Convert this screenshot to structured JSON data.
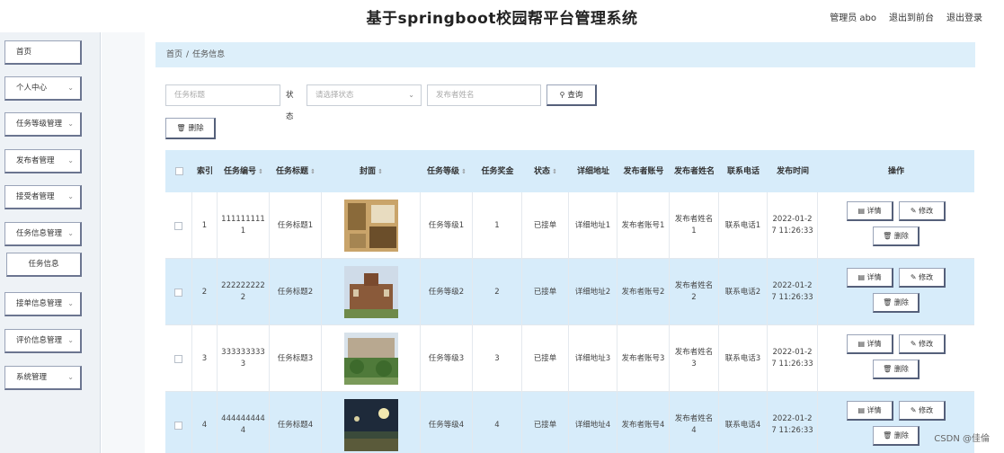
{
  "header": {
    "corner_text": "",
    "title": "基于springboot校园帮平台管理系统",
    "user_label": "管理员 abo",
    "exit_to_front": "退出到前台",
    "logout": "退出登录"
  },
  "sidebar": {
    "items": [
      {
        "label": "首页",
        "has_arrow": false
      },
      {
        "label": "个人中心",
        "has_arrow": true
      },
      {
        "label": "任务等级管理",
        "has_arrow": true
      },
      {
        "label": "发布者管理",
        "has_arrow": true
      },
      {
        "label": "接受者管理",
        "has_arrow": true
      },
      {
        "label": "任务信息管理",
        "has_arrow": true
      },
      {
        "label": "任务信息",
        "has_arrow": false,
        "sub": true
      },
      {
        "label": "接单信息管理",
        "has_arrow": true
      },
      {
        "label": "评价信息管理",
        "has_arrow": true
      },
      {
        "label": "系统管理",
        "has_arrow": true
      }
    ]
  },
  "breadcrumb": {
    "home": "首页",
    "separator": "/",
    "current": "任务信息"
  },
  "search": {
    "title_placeholder": "任务标题",
    "status_label": "状态",
    "status_placeholder": "请选择状态",
    "publisher_placeholder": "发布者姓名",
    "query_label": "查询"
  },
  "actions": {
    "delete_label": "删除"
  },
  "table": {
    "headers": [
      "",
      "索引",
      "任务编号",
      "任务标题",
      "封面",
      "任务等级",
      "任务奖金",
      "状态",
      "详细地址",
      "发布者账号",
      "发布者姓名",
      "联系电话",
      "发布时间",
      "操作"
    ],
    "op_labels": {
      "detail": "详情",
      "edit": "修改",
      "delete": "删除"
    },
    "rows": [
      {
        "index": "1",
        "task_no": "1111111111",
        "title": "任务标题1",
        "cover": "dorm-room-image",
        "level": "任务等级1",
        "bonus": "1",
        "status": "已接单",
        "address": "详细地址1",
        "account": "发布者账号1",
        "name": "发布者姓名1",
        "phone": "联系电话1",
        "time": "2022-01-27 11:26:33"
      },
      {
        "index": "2",
        "task_no": "2222222222",
        "title": "任务标题2",
        "cover": "campus-building-image",
        "level": "任务等级2",
        "bonus": "2",
        "status": "已接单",
        "address": "详细地址2",
        "account": "发布者账号2",
        "name": "发布者姓名2",
        "phone": "联系电话2",
        "time": "2022-01-27 11:26:33"
      },
      {
        "index": "3",
        "task_no": "3333333333",
        "title": "任务标题3",
        "cover": "campus-garden-image",
        "level": "任务等级3",
        "bonus": "3",
        "status": "已接单",
        "address": "详细地址3",
        "account": "发布者账号3",
        "name": "发布者姓名3",
        "phone": "联系电话3",
        "time": "2022-01-27 11:26:33"
      },
      {
        "index": "4",
        "task_no": "4444444444",
        "title": "任务标题4",
        "cover": "night-field-image",
        "level": "任务等级4",
        "bonus": "4",
        "status": "已接单",
        "address": "详细地址4",
        "account": "发布者账号4",
        "name": "发布者姓名4",
        "phone": "联系电话4",
        "time": "2022-01-27 11:26:33"
      }
    ]
  },
  "watermark": "CSDN @佳倫"
}
